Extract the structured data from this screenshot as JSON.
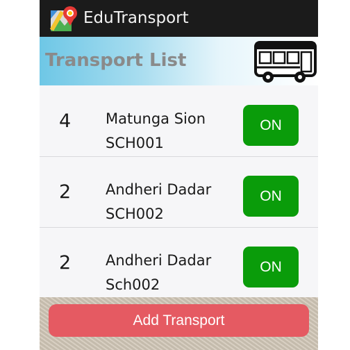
{
  "app": {
    "title": "EduTransport"
  },
  "banner": {
    "title": "Transport List"
  },
  "transports": [
    {
      "count": "4",
      "route": "Matunga Sion",
      "code": "SCH001",
      "status": "ON"
    },
    {
      "count": "2",
      "route": "Andheri Dadar",
      "code": "SCH002",
      "status": "ON"
    },
    {
      "count": "2",
      "route": "Andheri Dadar",
      "code": "Sch002",
      "status": "ON"
    }
  ],
  "footer": {
    "add_label": "Add Transport"
  },
  "colors": {
    "toggle_on": "#0a9c0a",
    "add_button": "#e55a62",
    "titlebar": "#1b1b1b"
  },
  "icons": {
    "app": "map-pin-icon",
    "banner": "bus-icon"
  }
}
